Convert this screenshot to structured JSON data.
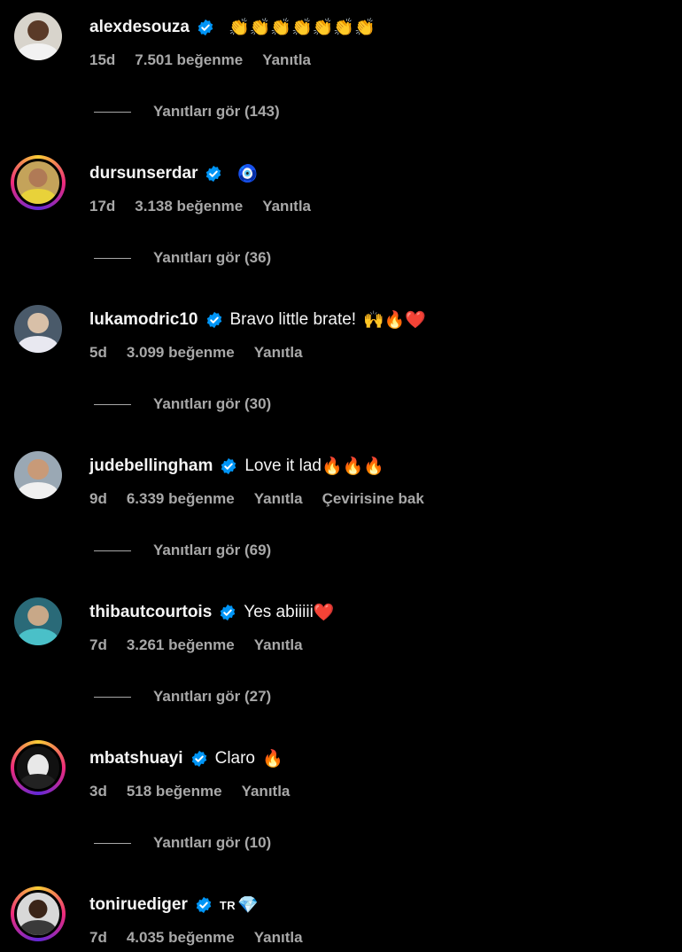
{
  "labels": {
    "reply": "Yanıtla",
    "translate": "Çevirisine bak"
  },
  "comments": [
    {
      "username": "alexdesouza",
      "text": "",
      "emoji": "👏👏👏👏👏👏👏",
      "time": "15d",
      "likes": "7.501 beğenme",
      "replies": "Yanıtları gör (143)"
    },
    {
      "username": "dursunserdar",
      "text": "",
      "emoji": "🧿",
      "time": "17d",
      "likes": "3.138 beğenme",
      "replies": "Yanıtları gör (36)"
    },
    {
      "username": "lukamodric10",
      "text": "Bravo little brate!",
      "emoji": "🙌🔥❤️",
      "time": "5d",
      "likes": "3.099 beğenme",
      "replies": "Yanıtları gör (30)"
    },
    {
      "username": "judebellingham",
      "text": "Love it lad",
      "emoji": "🔥🔥🔥",
      "time": "9d",
      "likes": "6.339 beğenme",
      "replies": "Yanıtları gör (69)"
    },
    {
      "username": "thibautcourtois",
      "text": "Yes abiiiii",
      "emoji": "❤️",
      "time": "7d",
      "likes": "3.261 beğenme",
      "replies": "Yanıtları gör (27)"
    },
    {
      "username": "mbatshuayi",
      "text": "Claro",
      "emoji": "🔥",
      "time": "3d",
      "likes": "518 beğenme",
      "replies": "Yanıtları gör (10)"
    },
    {
      "username": "toniruediger",
      "text": "",
      "tr_badge": "TR",
      "emoji": "💎",
      "time": "7d",
      "likes": "4.035 beğenme",
      "replies": ""
    }
  ],
  "colors": {
    "background": "#000000",
    "text": "#f5f5f5",
    "secondary": "#a8a8a8",
    "verified": "#0095f6"
  }
}
